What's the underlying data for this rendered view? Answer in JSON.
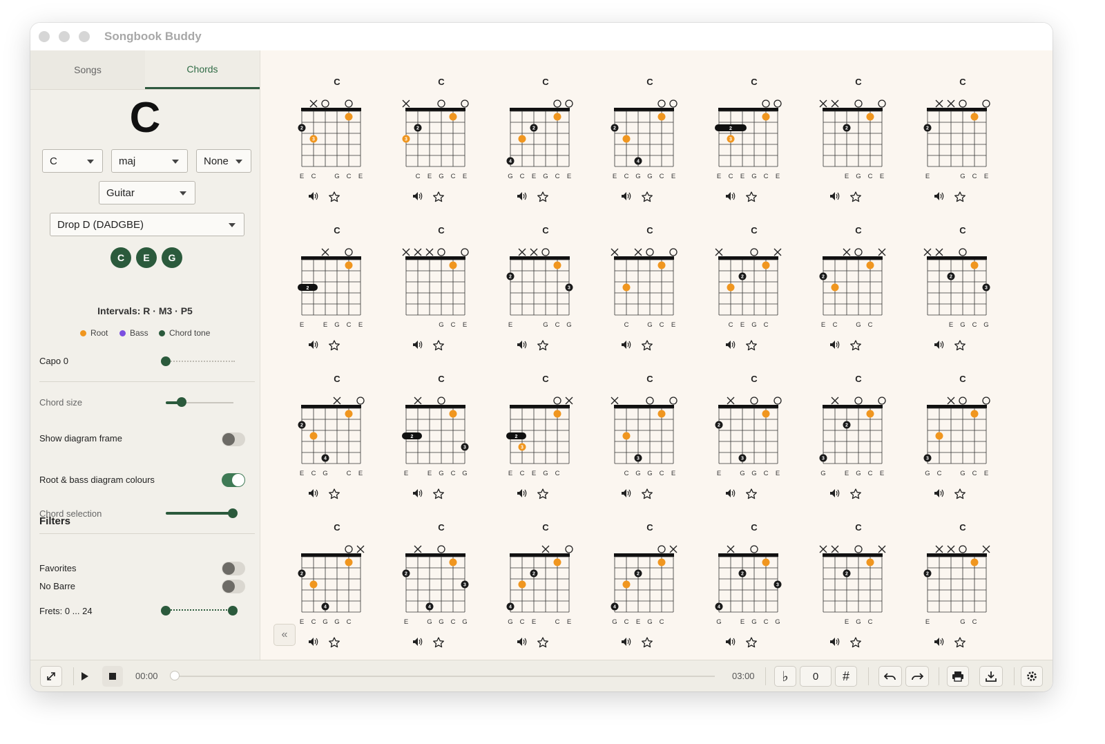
{
  "window": {
    "title": "Songbook Buddy"
  },
  "sidebar": {
    "tabs": [
      {
        "label": "Songs"
      },
      {
        "label": "Chords"
      }
    ],
    "chord_name": "C",
    "root_select": "C",
    "quality_select": "maj",
    "bass_select": "None",
    "instrument_select": "Guitar",
    "tuning_select": "Drop D (DADGBE)",
    "notes": [
      "C",
      "E",
      "G"
    ],
    "intervals": "Intervals: R · M3 · P5",
    "legend": [
      {
        "label": "Root",
        "color": "#f0961f"
      },
      {
        "label": "Bass",
        "color": "#7b4fe0"
      },
      {
        "label": "Chord tone",
        "color": "#2b5a3c"
      }
    ],
    "capo_label": "Capo 0",
    "chord_size_label": "Chord size",
    "show_frame_label": "Show diagram frame",
    "show_frame_on": false,
    "colours_label": "Root & bass diagram colours",
    "colours_on": true,
    "chord_selection_label": "Chord selection",
    "filters_heading": "Filters",
    "favorites_label": "Favorites",
    "favorites_on": false,
    "nobarre_label": "No Barre",
    "nobarre_on": false,
    "frets_label": "Frets: 0 ... 24"
  },
  "colors": {
    "accent": "#2b5a3c",
    "root": "#f0961f",
    "tone": "#1a1a1a"
  },
  "main": {
    "chords": [
      {
        "name": "C",
        "marks": "-xo-o-",
        "dots": [
          [
            5,
            1,
            "R",
            ""
          ],
          [
            1,
            2,
            "T",
            "2"
          ],
          [
            2,
            3,
            "R",
            "3"
          ]
        ],
        "barre": null,
        "notes": [
          "E",
          "C",
          "",
          "G",
          "C",
          "E"
        ]
      },
      {
        "name": "C",
        "marks": "x--o-o",
        "dots": [
          [
            5,
            1,
            "R",
            ""
          ],
          [
            2,
            2,
            "T",
            "2"
          ],
          [
            1,
            3,
            "R",
            "3"
          ]
        ],
        "barre": null,
        "notes": [
          "",
          "C",
          "E",
          "G",
          "C",
          "E"
        ]
      },
      {
        "name": "C",
        "marks": "----oo",
        "dots": [
          [
            5,
            1,
            "R",
            ""
          ],
          [
            3,
            2,
            "T",
            "2"
          ],
          [
            2,
            3,
            "R",
            ""
          ],
          [
            1,
            5,
            "T",
            "4"
          ]
        ],
        "barre": null,
        "notes": [
          "G",
          "C",
          "E",
          "G",
          "C",
          "E"
        ]
      },
      {
        "name": "C",
        "marks": "----oo",
        "dots": [
          [
            5,
            1,
            "R",
            ""
          ],
          [
            1,
            2,
            "T",
            "2"
          ],
          [
            2,
            3,
            "R",
            ""
          ],
          [
            3,
            5,
            "T",
            "4"
          ]
        ],
        "barre": null,
        "notes": [
          "E",
          "C",
          "G",
          "G",
          "C",
          "E"
        ]
      },
      {
        "name": "C",
        "marks": "----oo",
        "dots": [
          [
            5,
            1,
            "R",
            ""
          ],
          [
            2,
            3,
            "R",
            "3"
          ]
        ],
        "barre": [
          1,
          3,
          2,
          "2"
        ],
        "notes": [
          "E",
          "C",
          "E",
          "G",
          "C",
          "E"
        ]
      },
      {
        "name": "C",
        "marks": "xx-o-o",
        "dots": [
          [
            5,
            1,
            "R",
            ""
          ],
          [
            3,
            2,
            "T",
            "2"
          ]
        ],
        "barre": null,
        "notes": [
          "",
          "",
          "E",
          "G",
          "C",
          "E"
        ]
      },
      {
        "name": "C",
        "marks": "-xxo-o",
        "dots": [
          [
            5,
            1,
            "R",
            ""
          ],
          [
            1,
            2,
            "T",
            "2"
          ]
        ],
        "barre": null,
        "notes": [
          "E",
          "",
          "",
          "G",
          "C",
          "E"
        ]
      },
      {
        "name": "C",
        "marks": "--x-o-o",
        "dots": [
          [
            5,
            1,
            "R",
            ""
          ]
        ],
        "barre": [
          1,
          2,
          3,
          "2"
        ],
        "notes": [
          "E",
          "",
          "E",
          "G",
          "C",
          "E"
        ]
      },
      {
        "name": "C",
        "marks": "xxxo-o",
        "dots": [
          [
            5,
            1,
            "R",
            ""
          ]
        ],
        "barre": null,
        "notes": [
          "",
          "",
          "",
          "G",
          "C",
          "E"
        ]
      },
      {
        "name": "C",
        "marks": "-xxo--",
        "dots": [
          [
            5,
            1,
            "R",
            ""
          ],
          [
            1,
            2,
            "T",
            "2"
          ],
          [
            6,
            3,
            "T",
            "3"
          ]
        ],
        "barre": null,
        "notes": [
          "E",
          "",
          "",
          "G",
          "C",
          "G"
        ]
      },
      {
        "name": "C",
        "marks": "x-xo-o",
        "dots": [
          [
            5,
            1,
            "R",
            ""
          ],
          [
            2,
            3,
            "R",
            ""
          ]
        ],
        "barre": null,
        "notes": [
          "",
          "C",
          "",
          "G",
          "C",
          "E"
        ]
      },
      {
        "name": "C",
        "marks": "x--o-x",
        "dots": [
          [
            5,
            1,
            "R",
            ""
          ],
          [
            3,
            2,
            "T",
            "2"
          ],
          [
            2,
            3,
            "R",
            ""
          ]
        ],
        "barre": null,
        "notes": [
          "",
          "C",
          "E",
          "G",
          "C",
          ""
        ]
      },
      {
        "name": "C",
        "marks": "--xo-x",
        "dots": [
          [
            5,
            1,
            "R",
            ""
          ],
          [
            1,
            2,
            "T",
            "2"
          ],
          [
            2,
            3,
            "R",
            ""
          ]
        ],
        "barre": null,
        "notes": [
          "E",
          "C",
          "",
          "G",
          "C",
          ""
        ]
      },
      {
        "name": "C",
        "marks": "xx-o--",
        "dots": [
          [
            5,
            1,
            "R",
            ""
          ],
          [
            3,
            2,
            "T",
            "2"
          ],
          [
            6,
            3,
            "T",
            "3"
          ]
        ],
        "barre": null,
        "notes": [
          "",
          "",
          "E",
          "G",
          "C",
          "G"
        ]
      },
      {
        "name": "C",
        "marks": "---x-o",
        "dots": [
          [
            5,
            1,
            "R",
            ""
          ],
          [
            1,
            2,
            "T",
            "2"
          ],
          [
            2,
            3,
            "R",
            ""
          ],
          [
            3,
            5,
            "T",
            "4"
          ]
        ],
        "barre": null,
        "notes": [
          "E",
          "C",
          "G",
          "",
          "C",
          "E"
        ]
      },
      {
        "name": "C",
        "marks": "-x-o--",
        "dots": [
          [
            5,
            1,
            "R",
            ""
          ],
          [
            6,
            4,
            "T",
            "3"
          ]
        ],
        "barre": [
          1,
          2,
          3,
          "2"
        ],
        "notes": [
          "E",
          "",
          "E",
          "G",
          "C",
          "G"
        ]
      },
      {
        "name": "C",
        "marks": "----ox",
        "dots": [
          [
            5,
            1,
            "R",
            ""
          ],
          [
            2,
            4,
            "R",
            "3"
          ]
        ],
        "barre": [
          1,
          2,
          3,
          "2"
        ],
        "notes": [
          "E",
          "C",
          "E",
          "G",
          "C",
          ""
        ]
      },
      {
        "name": "C",
        "marks": "x--o-o",
        "dots": [
          [
            5,
            1,
            "R",
            ""
          ],
          [
            2,
            3,
            "R",
            ""
          ],
          [
            3,
            5,
            "T",
            "3"
          ]
        ],
        "barre": null,
        "notes": [
          "",
          "C",
          "G",
          "G",
          "C",
          "E"
        ]
      },
      {
        "name": "C",
        "marks": "-x-o-o",
        "dots": [
          [
            5,
            1,
            "R",
            ""
          ],
          [
            1,
            2,
            "T",
            "2"
          ],
          [
            3,
            5,
            "T",
            "3"
          ]
        ],
        "barre": null,
        "notes": [
          "E",
          "",
          "G",
          "G",
          "C",
          "E"
        ]
      },
      {
        "name": "C",
        "marks": "-x-o-o",
        "dots": [
          [
            5,
            1,
            "R",
            ""
          ],
          [
            3,
            2,
            "T",
            "2"
          ],
          [
            1,
            5,
            "T",
            "3"
          ]
        ],
        "barre": null,
        "notes": [
          "G",
          "",
          "E",
          "G",
          "C",
          "E"
        ]
      },
      {
        "name": "C",
        "marks": "--xo-o",
        "dots": [
          [
            5,
            1,
            "R",
            ""
          ],
          [
            2,
            3,
            "R",
            ""
          ],
          [
            1,
            5,
            "T",
            "3"
          ]
        ],
        "barre": null,
        "notes": [
          "G",
          "C",
          "",
          "G",
          "C",
          "E"
        ]
      },
      {
        "name": "C",
        "marks": "----ox",
        "dots": [
          [
            5,
            1,
            "R",
            ""
          ],
          [
            1,
            2,
            "T",
            "2"
          ],
          [
            2,
            3,
            "R",
            ""
          ],
          [
            3,
            5,
            "T",
            "4"
          ]
        ],
        "barre": null,
        "notes": [
          "E",
          "C",
          "G",
          "G",
          "C",
          ""
        ]
      },
      {
        "name": "C",
        "marks": "-x-o--",
        "dots": [
          [
            5,
            1,
            "R",
            ""
          ],
          [
            1,
            2,
            "T",
            "2"
          ],
          [
            3,
            5,
            "T",
            "4"
          ],
          [
            6,
            3,
            "T",
            "3"
          ]
        ],
        "barre": null,
        "notes": [
          "E",
          "",
          "G",
          "G",
          "C",
          "G"
        ]
      },
      {
        "name": "C",
        "marks": "---x-o",
        "dots": [
          [
            5,
            1,
            "R",
            ""
          ],
          [
            3,
            2,
            "T",
            "2"
          ],
          [
            2,
            3,
            "R",
            ""
          ],
          [
            1,
            5,
            "T",
            "4"
          ]
        ],
        "barre": null,
        "notes": [
          "G",
          "C",
          "E",
          "",
          "C",
          "E"
        ]
      },
      {
        "name": "C",
        "marks": "----ox",
        "dots": [
          [
            5,
            1,
            "R",
            ""
          ],
          [
            3,
            2,
            "T",
            "2"
          ],
          [
            2,
            3,
            "R",
            ""
          ],
          [
            1,
            5,
            "T",
            "4"
          ]
        ],
        "barre": null,
        "notes": [
          "G",
          "C",
          "E",
          "G",
          "C",
          ""
        ]
      },
      {
        "name": "C",
        "marks": "-x-o--",
        "dots": [
          [
            5,
            1,
            "R",
            ""
          ],
          [
            3,
            2,
            "T",
            "2"
          ],
          [
            1,
            5,
            "T",
            "4"
          ],
          [
            6,
            3,
            "T",
            "3"
          ]
        ],
        "barre": null,
        "notes": [
          "G",
          "",
          "E",
          "G",
          "C",
          "G"
        ]
      },
      {
        "name": "C",
        "marks": "xx-o-x",
        "dots": [
          [
            5,
            1,
            "R",
            ""
          ],
          [
            3,
            2,
            "T",
            "2"
          ]
        ],
        "barre": null,
        "notes": [
          "",
          "",
          "E",
          "G",
          "C",
          ""
        ]
      },
      {
        "name": "C",
        "marks": "-xxo-x",
        "dots": [
          [
            5,
            1,
            "R",
            ""
          ],
          [
            1,
            2,
            "T",
            "2"
          ]
        ],
        "barre": null,
        "notes": [
          "E",
          "",
          "",
          "G",
          "C",
          ""
        ]
      }
    ]
  },
  "player": {
    "time_current": "00:00",
    "time_total": "03:00",
    "progress": 0,
    "transpose_value": "0",
    "flat_symbol": "♭",
    "sharp_symbol": "#"
  }
}
